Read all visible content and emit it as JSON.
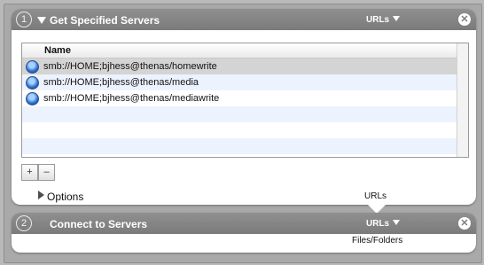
{
  "workflow": {
    "actions": [
      {
        "index": "1",
        "title": "Get Specified Servers",
        "types_label": "URLs",
        "table": {
          "column": "Name",
          "rows": [
            {
              "label": "smb://HOME;bjhess@thenas/homewrite",
              "selected": true
            },
            {
              "label": "smb://HOME;bjhess@thenas/media",
              "selected": false
            },
            {
              "label": "smb://HOME;bjhess@thenas/mediawrite",
              "selected": false
            }
          ]
        },
        "buttons": {
          "add": "+",
          "remove": "–"
        },
        "options_label": "Options",
        "output_label": "URLs"
      },
      {
        "index": "2",
        "title": "Connect to Servers",
        "types_label": "URLs",
        "input_label": "Files/Folders"
      }
    ]
  },
  "icons": {
    "server_icon": "globe-server-icon",
    "close_icon": "close-icon"
  },
  "colors": {
    "header": "#7f7f7f",
    "selected_row": "#d4d4d4",
    "alt_row": "#edf3fe"
  }
}
